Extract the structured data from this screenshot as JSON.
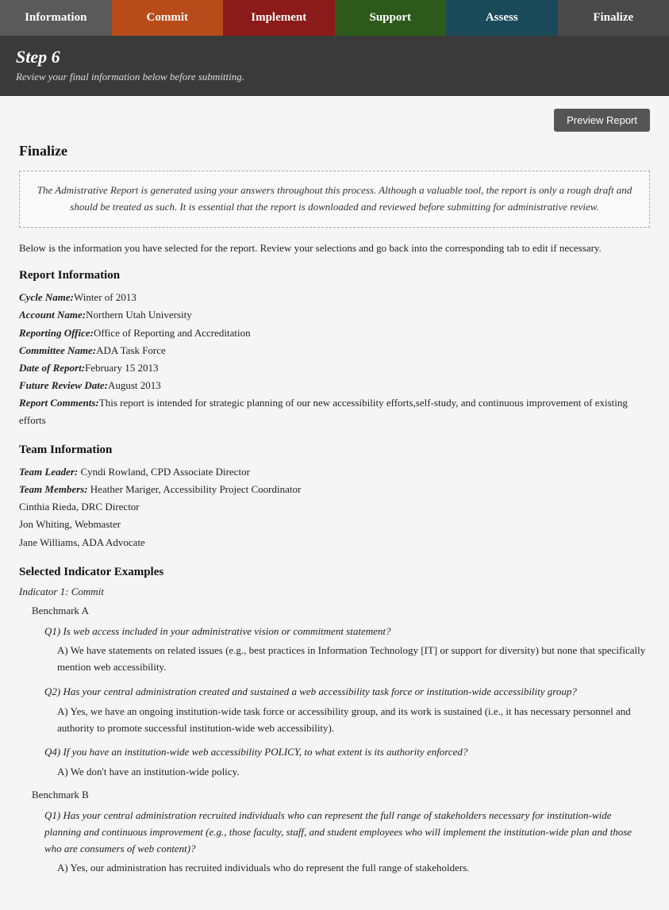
{
  "nav": {
    "tabs": [
      {
        "id": "information",
        "label": "Information",
        "class": "information"
      },
      {
        "id": "commit",
        "label": "Commit",
        "class": "commit"
      },
      {
        "id": "implement",
        "label": "Implement",
        "class": "implement"
      },
      {
        "id": "support",
        "label": "Support",
        "class": "support"
      },
      {
        "id": "assess",
        "label": "Assess",
        "class": "assess"
      },
      {
        "id": "finalize",
        "label": "Finalize",
        "class": "finalize"
      }
    ]
  },
  "step_header": {
    "step_label": "Step 6",
    "step_description": "Review your final information below before submitting."
  },
  "toolbar": {
    "preview_report_label": "Preview Report"
  },
  "finalize": {
    "title": "Finalize",
    "notice": "The Admistrative Report is generated using your answers throughout this process. Although a valuable tool, the report is only a rough draft and should be treated as such. It is essential that the report is downloaded and reviewed before submitting for administrative review.",
    "info_paragraph": "Below is the information you have selected for the report. Review your selections and go back into the corresponding tab to edit if necessary.",
    "report_info": {
      "heading": "Report Information",
      "fields": [
        {
          "label": "Cycle Name:",
          "value": "Winter of 2013"
        },
        {
          "label": "Account Name:",
          "value": "Northern Utah University"
        },
        {
          "label": "Reporting Office:",
          "value": "Office of Reporting and Accreditation"
        },
        {
          "label": "Committee Name:",
          "value": "ADA Task Force"
        },
        {
          "label": "Date of Report:",
          "value": "February 15 2013"
        },
        {
          "label": "Future Review Date:",
          "value": "August 2013"
        },
        {
          "label": "Report Comments:",
          "value": "This report is intended for strategic planning of our new accessibility efforts,self-study, and continuous improvement of existing efforts"
        }
      ]
    },
    "team_info": {
      "heading": "Team Information",
      "team_leader_label": "Team Leader:",
      "team_leader_value": "Cyndi Rowland, CPD Associate Director",
      "team_members_label": "Team Members:",
      "team_members": [
        "Heather Mariger, Accessibility Project Coordinator",
        "Cinthia Rieda, DRC Director",
        "Jon Whiting, Webmaster",
        "Jane Williams, ADA Advocate"
      ]
    },
    "selected_indicators": {
      "heading": "Selected Indicator Examples",
      "indicators": [
        {
          "label": "Indicator 1: Commit",
          "benchmarks": [
            {
              "label": "Benchmark A",
              "questions": [
                {
                  "question": "Q1) Is web access included in your administrative vision or commitment statement?",
                  "answer": "A) We have statements on related issues (e.g., best practices in Information Technology [IT] or support for diversity) but none that specifically mention web accessibility."
                },
                {
                  "question": "Q2) Has your central administration created and sustained a web accessibility task force or institution-wide accessibility group?",
                  "answer": "A) Yes, we have an ongoing institution-wide task force or accessibility group, and its work is sustained (i.e., it has necessary personnel and authority to promote successful institution-wide web accessibility)."
                },
                {
                  "question": "Q4) If you have an institution-wide web accessibility POLICY, to what extent is its authority enforced?",
                  "answer": "A) We don't have an institution-wide policy."
                }
              ]
            },
            {
              "label": "Benchmark B",
              "questions": [
                {
                  "question": "Q1) Has your central administration recruited individuals who can represent the full range of stakeholders necessary for institution-wide planning and continuous improvement (e.g., those faculty, staff, and student employees who will implement the institution-wide plan and those who are consumers of web content)?",
                  "answer": "A) Yes, our administration has recruited individuals who do represent the full range of stakeholders."
                }
              ]
            }
          ]
        }
      ]
    }
  }
}
